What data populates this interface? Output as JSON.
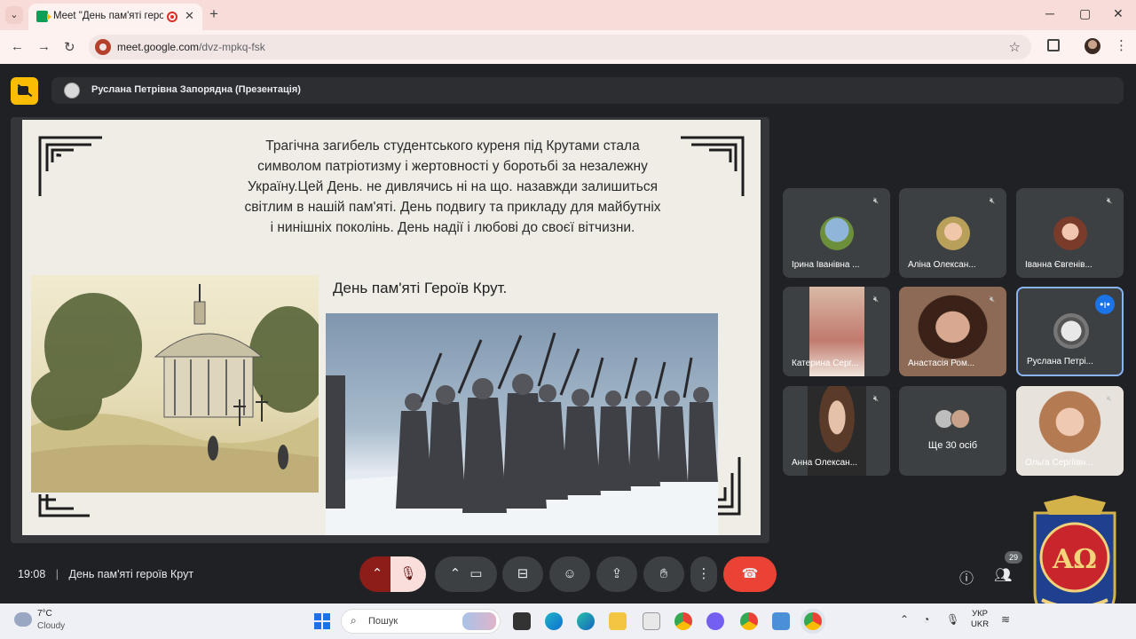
{
  "browser": {
    "tab_title": "Meet \"День пам'яті героя",
    "url": "meet.google.com/dvz-mpkq-fsk",
    "url_host": "meet.google.com",
    "url_path": "/dvz-mpkq-fsk",
    "win_min": "─",
    "win_max": "▢",
    "win_close": "✕"
  },
  "meet": {
    "presenter_label": "Руслана Петрівна Запорядна (Презентація)",
    "time": "19:08",
    "separator": "|",
    "meeting_title": "День пам'яті героїв Крут",
    "participant_count": "29",
    "participants": [
      {
        "name": "Ірина Іванівна ..."
      },
      {
        "name": "Аліна Олексан..."
      },
      {
        "name": "Іванна Євгенів..."
      },
      {
        "name": "Катерина Серг..."
      },
      {
        "name": "Анастасія Ром..."
      },
      {
        "name": "Руслана Петрі..."
      },
      {
        "name": "Анна Олексан..."
      },
      {
        "name": "Ще 30 осіб"
      },
      {
        "name": "Ольга Сергіївн..."
      }
    ]
  },
  "slide": {
    "text": "Трагічна загибель студентського куреня під Крутами стала символом патріотизму і жертовності у боротьбі за незалежну Україну.Цей День. не дивлячись ні на що. назавжди залишиться світлим в нашій пам'яті. День подвигу та прикладу для майбутніх і нинішніх поколінь. День надії і любові до своєї вітчизни.",
    "heading": "День пам'яті Героїв Крут."
  },
  "taskbar": {
    "temp": "7°C",
    "weather": "Cloudy",
    "search_placeholder": "Пошук",
    "lang_top": "УКР",
    "lang_bottom": "UKR"
  },
  "emblem": {
    "letters": "AΩ"
  },
  "colors": {
    "meet_bg": "#202124",
    "end_call": "#ea4335",
    "active_border": "#8ab4f8",
    "cam_off": "#fbbc04"
  }
}
